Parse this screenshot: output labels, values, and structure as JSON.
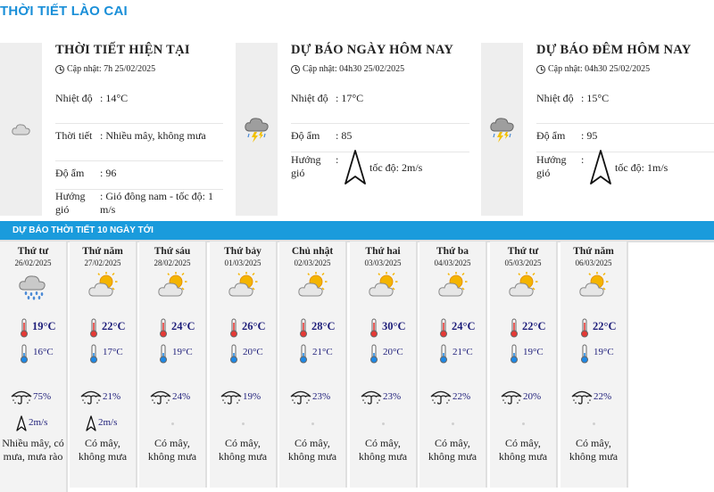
{
  "page_title": "THỜI TIẾT LÀO CAI",
  "current": {
    "title": "THỜI TIẾT HIỆN TẠI",
    "updated": "Cập nhật: 7h 25/02/2025",
    "icon": "cloudy-icon",
    "temp_label": "Nhiệt độ",
    "temp_value": ": 14°C",
    "weather_label": "Thời tiết",
    "weather_value": ": Nhiều mây, không mưa",
    "humidity_label": "Độ ẩm",
    "humidity_value": ": 96",
    "wind_label": "Hướng gió",
    "wind_value": ": Gió đông nam - tốc độ: 1 m/s"
  },
  "today": {
    "title": "DỰ BÁO NGÀY HÔM NAY",
    "updated": "Cập nhật: 04h30 25/02/2025",
    "icon": "thunderstorm-icon",
    "temp_label": "Nhiệt độ",
    "temp_value": ": 17°C",
    "humidity_label": "Độ ẩm",
    "humidity_value": ": 85",
    "wind_label": "Hướng gió",
    "wind_colon": ":",
    "wind_speed": "tốc độ: 2m/s"
  },
  "tonight": {
    "title": "DỰ BÁO ĐÊM HÔM NAY",
    "updated": "Cập nhật: 04h30 25/02/2025",
    "icon": "thunderstorm-icon",
    "temp_label": "Nhiệt độ",
    "temp_value": ": 15°C",
    "humidity_label": "Độ ẩm",
    "humidity_value": ": 95",
    "wind_label": "Hướng gió",
    "wind_colon": ":",
    "wind_speed": "tốc độ: 1m/s"
  },
  "forecast": {
    "title": "DỰ BÁO THỜI TIẾT 10 NGÀY TỚI",
    "days": [
      {
        "name": "Thứ tư",
        "date": "26/02/2025",
        "icon": "rain-cloud-icon",
        "tmax": "19°C",
        "tmin": "16°C",
        "rain": "75%",
        "wind": "2m/s",
        "desc": "Nhiều mây, có mưa, mưa rào"
      },
      {
        "name": "Thứ năm",
        "date": "27/02/2025",
        "icon": "sun-cloud-icon",
        "tmax": "22°C",
        "tmin": "17°C",
        "rain": "21%",
        "wind": "2m/s",
        "desc": "Có mây, không mưa"
      },
      {
        "name": "Thứ sáu",
        "date": "28/02/2025",
        "icon": "sun-cloud-icon",
        "tmax": "24°C",
        "tmin": "19°C",
        "rain": "24%",
        "wind": "",
        "desc": "Có mây, không mưa"
      },
      {
        "name": "Thứ bảy",
        "date": "01/03/2025",
        "icon": "sun-cloud-icon",
        "tmax": "26°C",
        "tmin": "20°C",
        "rain": "19%",
        "wind": "",
        "desc": "Có mây, không mưa"
      },
      {
        "name": "Chủ nhật",
        "date": "02/03/2025",
        "icon": "sun-cloud-icon",
        "tmax": "28°C",
        "tmin": "21°C",
        "rain": "23%",
        "wind": "",
        "desc": "Có mây, không mưa"
      },
      {
        "name": "Thứ hai",
        "date": "03/03/2025",
        "icon": "sun-cloud-icon",
        "tmax": "30°C",
        "tmin": "20°C",
        "rain": "23%",
        "wind": "",
        "desc": "Có mây, không mưa"
      },
      {
        "name": "Thứ ba",
        "date": "04/03/2025",
        "icon": "sun-cloud-icon",
        "tmax": "24°C",
        "tmin": "21°C",
        "rain": "22%",
        "wind": "",
        "desc": "Có mây, không mưa"
      },
      {
        "name": "Thứ tư",
        "date": "05/03/2025",
        "icon": "sun-cloud-icon",
        "tmax": "22°C",
        "tmin": "19°C",
        "rain": "20%",
        "wind": "",
        "desc": "Có mây, không mưa"
      },
      {
        "name": "Thứ năm",
        "date": "06/03/2025",
        "icon": "sun-cloud-icon",
        "tmax": "22°C",
        "tmin": "19°C",
        "rain": "22%",
        "wind": "",
        "desc": "Có mây, không mưa"
      }
    ]
  },
  "colors": {
    "accent": "#1a9bdc",
    "title": "#1a8fd8",
    "temp_text": "#1e1e7a"
  }
}
